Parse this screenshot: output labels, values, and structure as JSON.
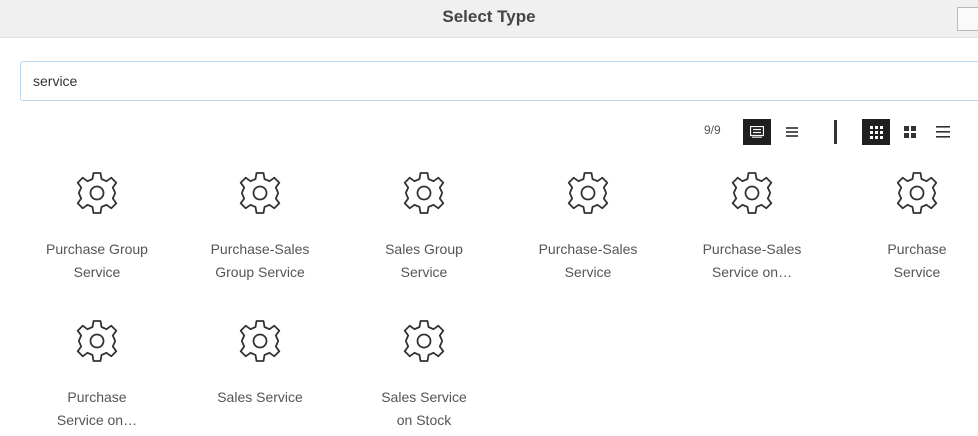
{
  "dialog": {
    "title": "Select Type"
  },
  "search": {
    "value": "service"
  },
  "toolbar": {
    "count": "9/9",
    "view_buttons": [
      {
        "name": "card-view-button",
        "icon": "card-list-icon",
        "active": true
      },
      {
        "name": "list-compact-button",
        "icon": "compact-list-icon",
        "active": false
      },
      {
        "name": "large-grid-button",
        "icon": "grid-large-icon",
        "active": true
      },
      {
        "name": "small-grid-button",
        "icon": "grid-small-icon",
        "active": false
      },
      {
        "name": "list-view-button",
        "icon": "list-lines-icon",
        "active": false
      }
    ]
  },
  "items": [
    {
      "label": "Purchase Group Service",
      "icon": "gear-icon"
    },
    {
      "label": "Purchase-Sales Group Service",
      "icon": "gear-icon"
    },
    {
      "label": "Sales Group Service",
      "icon": "gear-icon"
    },
    {
      "label": "Purchase-Sales Service",
      "icon": "gear-icon"
    },
    {
      "label": "Purchase-Sales Service on…",
      "icon": "gear-icon"
    },
    {
      "label": "Purchase Service",
      "icon": "gear-icon"
    },
    {
      "label": "Purchase Service on…",
      "icon": "gear-icon"
    },
    {
      "label": "Sales Service",
      "icon": "gear-icon"
    },
    {
      "label": "Sales Service on Stock",
      "icon": "gear-icon"
    }
  ]
}
